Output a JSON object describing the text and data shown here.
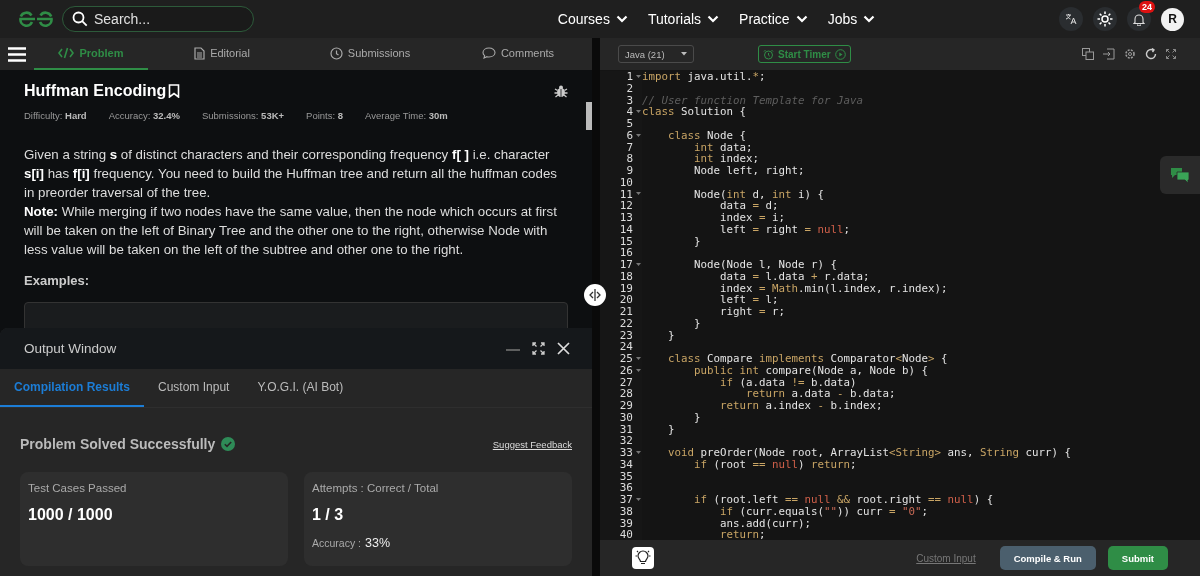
{
  "top_nav": {
    "search_placeholder": "Search...",
    "menus": [
      "Courses",
      "Tutorials",
      "Practice",
      "Jobs"
    ],
    "notification_count": "24",
    "avatar": "R"
  },
  "problem_tabs": [
    {
      "label": "Problem",
      "selected": true
    },
    {
      "label": "Editorial",
      "selected": false
    },
    {
      "label": "Submissions",
      "selected": false
    },
    {
      "label": "Comments",
      "selected": false
    }
  ],
  "problem": {
    "title": "Huffman Encoding",
    "meta": [
      "Difficulty: **Hard**",
      "Accuracy: **32.4%**",
      "Submissions: **53K+**",
      "Points: **8**",
      "Average Time: **30m**"
    ],
    "paragraphs": [
      "Given a string **s** of distinct characters and their corresponding frequency **f[ ]** i.e. character **s[i]** has **f[i]** frequency. You need to build the Huffman tree and return all the huffman codes in preorder traversal of the tree.",
      "**Note:** While merging if two nodes have the same value, then the node which occurs at first will be taken on the left of Binary Tree and the other one to the right, otherwise Node with less value will be taken on the left of the subtree and other one to the right."
    ],
    "examples_label": "Examples:"
  },
  "output_window": {
    "title": "Output Window",
    "tabs": [
      {
        "label": "Compilation Results",
        "selected": true
      },
      {
        "label": "Custom Input",
        "selected": false
      },
      {
        "label": "Y.O.G.I. (AI Bot)",
        "selected": false
      }
    ],
    "status": "Problem Solved Successfully",
    "feedback_link": "Suggest Feedback",
    "cards": [
      {
        "label": "Test Cases Passed",
        "value": "1000 / 1000"
      },
      {
        "label": "Attempts : Correct / Total",
        "value": "1 / 3",
        "extra_label": "Accuracy :",
        "extra_value": "33%"
      }
    ]
  },
  "editor": {
    "language": "Java (21)",
    "timer": "Start Timer",
    "lines": [
      {
        "number": "1",
        "fold": true,
        "segments": [
          {
            "kind": "keyword",
            "text": "import"
          },
          {
            "text": " java.util."
          },
          {
            "kind": "operator",
            "text": "*"
          },
          {
            "text": ";"
          }
        ]
      },
      {
        "number": "2",
        "fold": false
      },
      {
        "number": "3",
        "fold": false,
        "segments": [
          {
            "kind": "comment",
            "text": "// User function Template for Java"
          }
        ]
      },
      {
        "number": "4",
        "fold": true,
        "segments": [
          {
            "kind": "keyword",
            "text": "class"
          },
          {
            "text": " Solution {"
          }
        ]
      },
      {
        "number": "5",
        "fold": false
      },
      {
        "number": "6",
        "fold": true,
        "segments": [
          {
            "kind": "keyword",
            "text": "    class"
          },
          {
            "text": " Node {"
          }
        ]
      },
      {
        "number": "7",
        "fold": false,
        "segments": [
          {
            "kind": "keyword",
            "text": "        int"
          },
          {
            "text": " data;"
          }
        ]
      },
      {
        "number": "8",
        "fold": false,
        "segments": [
          {
            "kind": "keyword",
            "text": "        int"
          },
          {
            "text": " index;"
          }
        ]
      },
      {
        "number": "9",
        "fold": false,
        "segments": [
          {
            "text": "        Node left, right;"
          }
        ]
      },
      {
        "number": "10",
        "fold": false
      },
      {
        "number": "11",
        "fold": true,
        "segments": [
          {
            "text": "        Node("
          },
          {
            "kind": "keyword",
            "text": "int"
          },
          {
            "text": " d, "
          },
          {
            "kind": "keyword",
            "text": "int"
          },
          {
            "text": " i) {"
          }
        ]
      },
      {
        "number": "12",
        "fold": false,
        "segments": [
          {
            "text": "            data "
          },
          {
            "kind": "operator",
            "text": "="
          },
          {
            "text": " d;"
          }
        ]
      },
      {
        "number": "13",
        "fold": false,
        "segments": [
          {
            "text": "            index "
          },
          {
            "kind": "operator",
            "text": "="
          },
          {
            "text": " i;"
          }
        ]
      },
      {
        "number": "14",
        "fold": false,
        "segments": [
          {
            "text": "            left "
          },
          {
            "kind": "operator",
            "text": "="
          },
          {
            "text": " right "
          },
          {
            "kind": "operator",
            "text": "="
          },
          {
            "kind": "literal",
            "text": " null"
          },
          {
            "text": ";"
          }
        ]
      },
      {
        "number": "15",
        "fold": false,
        "segments": [
          {
            "text": "        }"
          }
        ]
      },
      {
        "number": "16",
        "fold": false
      },
      {
        "number": "17",
        "fold": true,
        "segments": [
          {
            "text": "        Node(Node l, Node r) {"
          }
        ]
      },
      {
        "number": "18",
        "fold": false,
        "segments": [
          {
            "text": "            data "
          },
          {
            "kind": "operator",
            "text": "="
          },
          {
            "text": " l.data "
          },
          {
            "kind": "operator",
            "text": "+"
          },
          {
            "text": " r.data;"
          }
        ]
      },
      {
        "number": "19",
        "fold": false,
        "segments": [
          {
            "text": "            index "
          },
          {
            "kind": "operator",
            "text": "="
          },
          {
            "kind": "keyword",
            "text": " Math"
          },
          {
            "text": ".min(l.index, r.index);"
          }
        ]
      },
      {
        "number": "20",
        "fold": false,
        "segments": [
          {
            "text": "            left "
          },
          {
            "kind": "operator",
            "text": "="
          },
          {
            "text": " l;"
          }
        ]
      },
      {
        "number": "21",
        "fold": false,
        "segments": [
          {
            "text": "            right "
          },
          {
            "kind": "operator",
            "text": "="
          },
          {
            "text": " r;"
          }
        ]
      },
      {
        "number": "22",
        "fold": false,
        "segments": [
          {
            "text": "        }"
          }
        ]
      },
      {
        "number": "23",
        "fold": false,
        "segments": [
          {
            "text": "    }"
          }
        ]
      },
      {
        "number": "24",
        "fold": false
      },
      {
        "number": "25",
        "fold": true,
        "segments": [
          {
            "kind": "keyword",
            "text": "    class"
          },
          {
            "text": " Compare "
          },
          {
            "kind": "keyword",
            "text": "implements"
          },
          {
            "text": " Comparator"
          },
          {
            "kind": "operator",
            "text": "<"
          },
          {
            "text": "Node"
          },
          {
            "kind": "operator",
            "text": ">"
          },
          {
            "text": " {"
          }
        ]
      },
      {
        "number": "26",
        "fold": true,
        "segments": [
          {
            "kind": "keyword",
            "text": "        public int"
          },
          {
            "text": " compare(Node a, Node b) {"
          }
        ]
      },
      {
        "number": "27",
        "fold": false,
        "segments": [
          {
            "kind": "keyword",
            "text": "            if"
          },
          {
            "text": " (a.data "
          },
          {
            "kind": "operator",
            "text": "!="
          },
          {
            "text": " b.data)"
          }
        ]
      },
      {
        "number": "28",
        "fold": false,
        "segments": [
          {
            "kind": "keyword",
            "text": "                return"
          },
          {
            "text": " a.data "
          },
          {
            "kind": "operator",
            "text": "-"
          },
          {
            "text": " b.data;"
          }
        ]
      },
      {
        "number": "29",
        "fold": false,
        "segments": [
          {
            "kind": "keyword",
            "text": "            return"
          },
          {
            "text": " a.index "
          },
          {
            "kind": "operator",
            "text": "-"
          },
          {
            "text": " b.index;"
          }
        ]
      },
      {
        "number": "30",
        "fold": false,
        "segments": [
          {
            "text": "        }"
          }
        ]
      },
      {
        "number": "31",
        "fold": false,
        "segments": [
          {
            "text": "    }"
          }
        ]
      },
      {
        "number": "32",
        "fold": false
      },
      {
        "number": "33",
        "fold": true,
        "segments": [
          {
            "kind": "keyword",
            "text": "    void"
          },
          {
            "text": " preOrder(Node root, ArrayList"
          },
          {
            "kind": "operator",
            "text": "<String>"
          },
          {
            "text": " ans, "
          },
          {
            "kind": "keyword",
            "text": "String"
          },
          {
            "text": " curr) {"
          }
        ]
      },
      {
        "number": "34",
        "fold": false,
        "segments": [
          {
            "kind": "keyword",
            "text": "        if"
          },
          {
            "text": " (root "
          },
          {
            "kind": "operator",
            "text": "=="
          },
          {
            "kind": "literal",
            "text": " null"
          },
          {
            "text": ") "
          },
          {
            "kind": "keyword",
            "text": "return"
          },
          {
            "text": ";"
          }
        ]
      },
      {
        "number": "35",
        "fold": false
      },
      {
        "number": "36",
        "fold": false
      },
      {
        "number": "37",
        "fold": true,
        "segments": [
          {
            "kind": "keyword",
            "text": "        if"
          },
          {
            "text": " (root.left "
          },
          {
            "kind": "operator",
            "text": "=="
          },
          {
            "kind": "literal",
            "text": " null"
          },
          {
            "kind": "operator",
            "text": " &&"
          },
          {
            "text": " root.right "
          },
          {
            "kind": "operator",
            "text": "=="
          },
          {
            "kind": "literal",
            "text": " null"
          },
          {
            "text": ") {"
          }
        ]
      },
      {
        "number": "38",
        "fold": false,
        "segments": [
          {
            "kind": "keyword",
            "text": "            if"
          },
          {
            "text": " (curr.equals("
          },
          {
            "kind": "string",
            "text": "\"\""
          },
          {
            "text": ")) curr "
          },
          {
            "kind": "operator",
            "text": "="
          },
          {
            "kind": "string",
            "text": " \"0\""
          },
          {
            "text": ";"
          }
        ]
      },
      {
        "number": "39",
        "fold": false,
        "segments": [
          {
            "text": "            ans.add(curr);"
          }
        ]
      },
      {
        "number": "40",
        "fold": false,
        "segments": [
          {
            "kind": "keyword",
            "text": "            return"
          },
          {
            "text": ";"
          }
        ]
      }
    ]
  },
  "editor_footer": {
    "custom_input": "Custom Input",
    "compile_button": "Compile & Run",
    "submit_button": "Submit"
  }
}
